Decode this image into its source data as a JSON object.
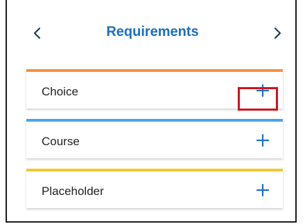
{
  "header": {
    "title": "Requirements",
    "prev_icon": "chevron-left-icon",
    "next_icon": "chevron-right-icon"
  },
  "requirements": [
    {
      "label": "Choice",
      "stripe_color": "#f7913d",
      "action_icon": "plus-icon",
      "highlighted": true
    },
    {
      "label": "Course",
      "stripe_color": "#4da3ea",
      "action_icon": "plus-icon",
      "highlighted": false
    },
    {
      "label": "Placeholder",
      "stripe_color": "#f2c82f",
      "action_icon": "plus-icon",
      "highlighted": false
    }
  ],
  "colors": {
    "accent": "#1a6fc4",
    "highlight": "#d0111b",
    "text": "#222222"
  }
}
